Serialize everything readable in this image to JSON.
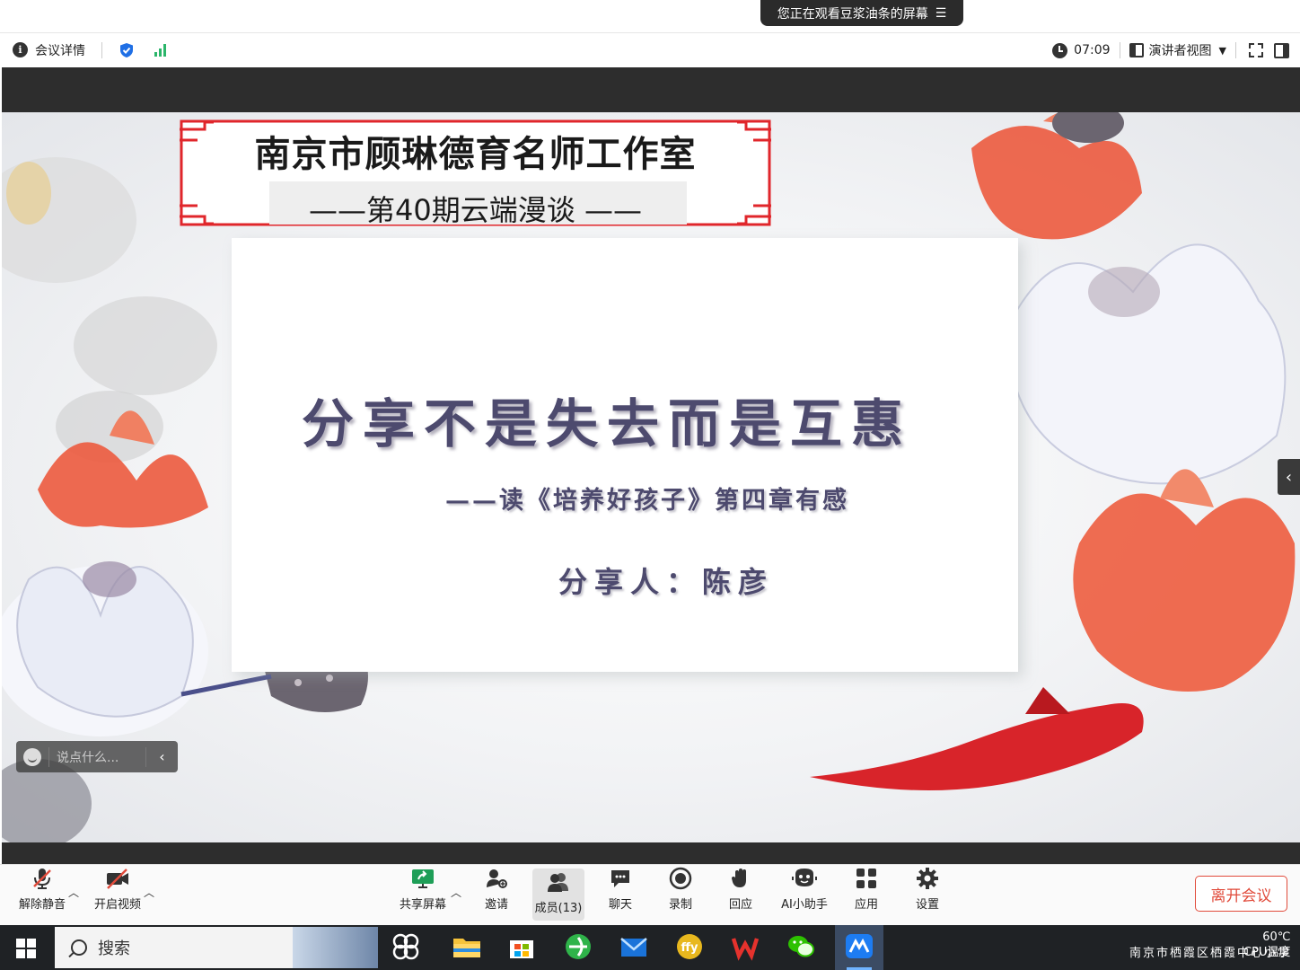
{
  "banner": {
    "text": "您正在观看豆浆油条的屏幕",
    "menu_glyph": "☰"
  },
  "topbar": {
    "meeting_details": "会议详情",
    "timer": "07:09",
    "view_mode": "演讲者视图"
  },
  "slide": {
    "title_main": "南京市顾琳德育名师工作室",
    "title_sub": "——第40期云端漫谈 ——",
    "heading": "分享不是失去而是互惠",
    "subheading": "——读《培养好孩子》第四章有感",
    "author": "分享人：陈彦"
  },
  "chat": {
    "placeholder": "说点什么..."
  },
  "toolbar": {
    "unmute": "解除静音",
    "start_video": "开启视频",
    "share_screen": "共享屏幕",
    "invite": "邀请",
    "participants": "成员(13)",
    "chat": "聊天",
    "record": "录制",
    "reactions": "回应",
    "ai_assistant": "AI小助手",
    "apps": "应用",
    "settings": "设置",
    "leave": "离开会议"
  },
  "taskbar": {
    "search_label": "搜索",
    "tray_text": "南京市栖霞区栖霞中心小学",
    "temperature": "60℃",
    "temperature_label": "CPU温度"
  },
  "colors": {
    "accent_red": "#e14b3b",
    "signal_green": "#2bb56a",
    "shield_blue": "#1f6fe5",
    "slide_text": "#4d4a6e"
  }
}
